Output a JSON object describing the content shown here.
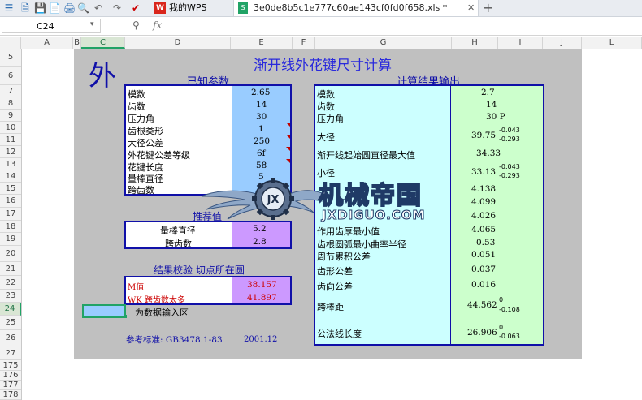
{
  "titlebar": {
    "wps_tab": "我的WPS",
    "file_tab": "3e0de8b5c1e777c60ae143cf0fd0f658.xls *",
    "plus": "+"
  },
  "formula_bar": {
    "cell_ref": "C24",
    "fx": "fx",
    "value": ""
  },
  "columns": [
    "A",
    "B",
    "C",
    "D",
    "E",
    "F",
    "G",
    "H",
    "I",
    "J",
    "L"
  ],
  "rows": [
    "5",
    "6",
    "7",
    "8",
    "9",
    "10",
    "11",
    "12",
    "13",
    "14",
    "15",
    "16",
    "17",
    "18",
    "19",
    "20",
    "21",
    "22",
    "23",
    "24",
    "25",
    "26",
    "27",
    "175",
    "176",
    "177",
    "178"
  ],
  "sheet": {
    "big_char": "外",
    "title": "渐开线外花键尺寸计算",
    "known_header": "已知参数",
    "output_header": "计算结果输出",
    "known": [
      {
        "label": "模数",
        "value": "2.65"
      },
      {
        "label": "齿数",
        "value": "14"
      },
      {
        "label": "压力角",
        "value": "30"
      },
      {
        "label": "齿根类形",
        "value": "1"
      },
      {
        "label": "大径公差",
        "value": "250"
      },
      {
        "label": "外花键公差等级",
        "value": "6f"
      },
      {
        "label": "花键长度",
        "value": "58"
      },
      {
        "label": "量棒直径",
        "value": "5"
      },
      {
        "label": "跨齿数",
        "value": ""
      }
    ],
    "recommend_header": "推荐值",
    "recommend": [
      {
        "label": "量棒直径",
        "value": "5.2"
      },
      {
        "label": "跨齿数",
        "value": "2.8"
      }
    ],
    "check_header": "结果校验  切点所在圆",
    "check": [
      {
        "label": "M值",
        "value": "38.157"
      },
      {
        "label": "WK  跨齿数太多",
        "value": "41.897"
      }
    ],
    "input_legend": "为数据输入区",
    "reference": "参考标准: GB3478.1-83",
    "date": "2001.12",
    "results": [
      {
        "label": "模数",
        "value": "2.7",
        "upper": "",
        "lower": ""
      },
      {
        "label": "齿数",
        "value": "14",
        "upper": "",
        "lower": ""
      },
      {
        "label": "压力角",
        "value": "30 P",
        "upper": "",
        "lower": ""
      },
      {
        "label": "大径",
        "value": "39.75",
        "upper": "-0.043",
        "lower": "-0.293"
      },
      {
        "label": "渐开线起始圆直径最大值",
        "value": "34.33",
        "upper": "",
        "lower": ""
      },
      {
        "label": "小径",
        "value": "33.13",
        "upper": "-0.043",
        "lower": "-0.293"
      },
      {
        "label": "",
        "value": "4.138",
        "upper": "",
        "lower": ""
      },
      {
        "label": "",
        "value": "4.099",
        "upper": "",
        "lower": ""
      },
      {
        "label": "",
        "value": "4.026",
        "upper": "",
        "lower": ""
      },
      {
        "label": "作用齿厚最小值",
        "value": "4.065",
        "upper": "",
        "lower": ""
      },
      {
        "label": "齿根圆弧最小曲率半径",
        "value": "0.53",
        "upper": "",
        "lower": ""
      },
      {
        "label": "周节累积公差",
        "value": "0.051",
        "upper": "",
        "lower": ""
      },
      {
        "label": "齿形公差",
        "value": "0.037",
        "upper": "",
        "lower": ""
      },
      {
        "label": "齿向公差",
        "value": "0.016",
        "upper": "",
        "lower": ""
      },
      {
        "label": "跨棒距",
        "value": "44.562",
        "upper": "0",
        "lower": "-0.108"
      },
      {
        "label": "公法线长度",
        "value": "26.906",
        "upper": "0",
        "lower": "-0.063"
      }
    ]
  },
  "watermark": {
    "cn": "机械帝国",
    "en": "JXDIGUO.COM",
    "badge": "JX"
  },
  "colors": {
    "blue": "#1010a8",
    "sky": "#99ccff",
    "violet": "#cc99ff",
    "cyan": "#ccffff",
    "mint": "#ccffcc",
    "green": "#21a366"
  }
}
